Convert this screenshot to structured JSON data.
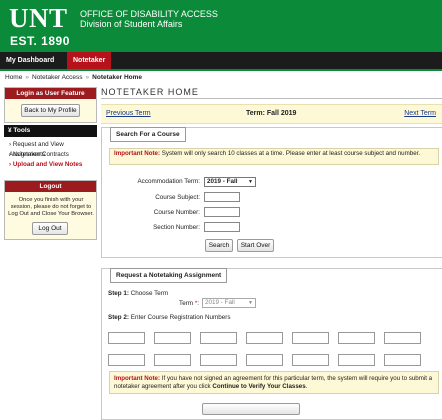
{
  "header": {
    "logo": "UNT",
    "logo_est": "EST. 1890",
    "office_title": "OFFICE OF DISABILITY ACCESS",
    "office_subtitle": "Division of Student Affairs",
    "brand_color": "#0b8a3a"
  },
  "nav": {
    "tabs": [
      {
        "label": "My Dashboard",
        "active": false
      },
      {
        "label": "Notetaker",
        "active": true
      }
    ],
    "accent_color": "#b5121b"
  },
  "breadcrumb": {
    "items": [
      "Home",
      "Notetaker Access"
    ],
    "current": "Notetaker Home",
    "separator": "»"
  },
  "sidebar": {
    "login_box": {
      "title": "Login as User Feature",
      "button": "Back to My Profile"
    },
    "tools": {
      "title": "Tools",
      "items": [
        {
          "label": "Request and View Assignments",
          "active": false
        },
        {
          "label": "Notetaker Contracts",
          "active": false
        },
        {
          "label": "Upload and View Notes",
          "active": true
        }
      ]
    },
    "logout_box": {
      "title": "Logout",
      "message": "Once you finish with your session, please do not forget to Log Out and Close Your Browser.",
      "button": "Log Out"
    }
  },
  "main": {
    "title": "NOTETAKER HOME",
    "term_bar": {
      "prev": "Previous Term",
      "term": "Term: Fall 2019",
      "next": "Next Term"
    },
    "search": {
      "legend": "Search For a Course",
      "note_label": "Important Note:",
      "note_text": "System will only search 10 classes at a time. Please enter at least course subject and number.",
      "accommodation_term_label": "Accommodation Term:",
      "accommodation_term_value": "2019 - Fall",
      "course_subject_label": "Course Subject:",
      "course_number_label": "Course Number:",
      "section_number_label": "Section Number:",
      "search_button": "Search",
      "start_over_button": "Start Over"
    },
    "request": {
      "legend": "Request a Notetaking Assignment",
      "step1_label": "Step 1:",
      "step1_text": "Choose Term",
      "term_label": "Term",
      "term_required": "*",
      "term_value": "2019 - Fall",
      "step2_label": "Step 2:",
      "step2_text": "Enter Course Registration Numbers",
      "note_label": "Important Note:",
      "note_text": "If you have not signed an agreement for this particular term, the system will require you to submit a notetaker agreement after you click",
      "note_emphasis": "Continue to Verify Your Classes",
      "note_end": "."
    }
  }
}
